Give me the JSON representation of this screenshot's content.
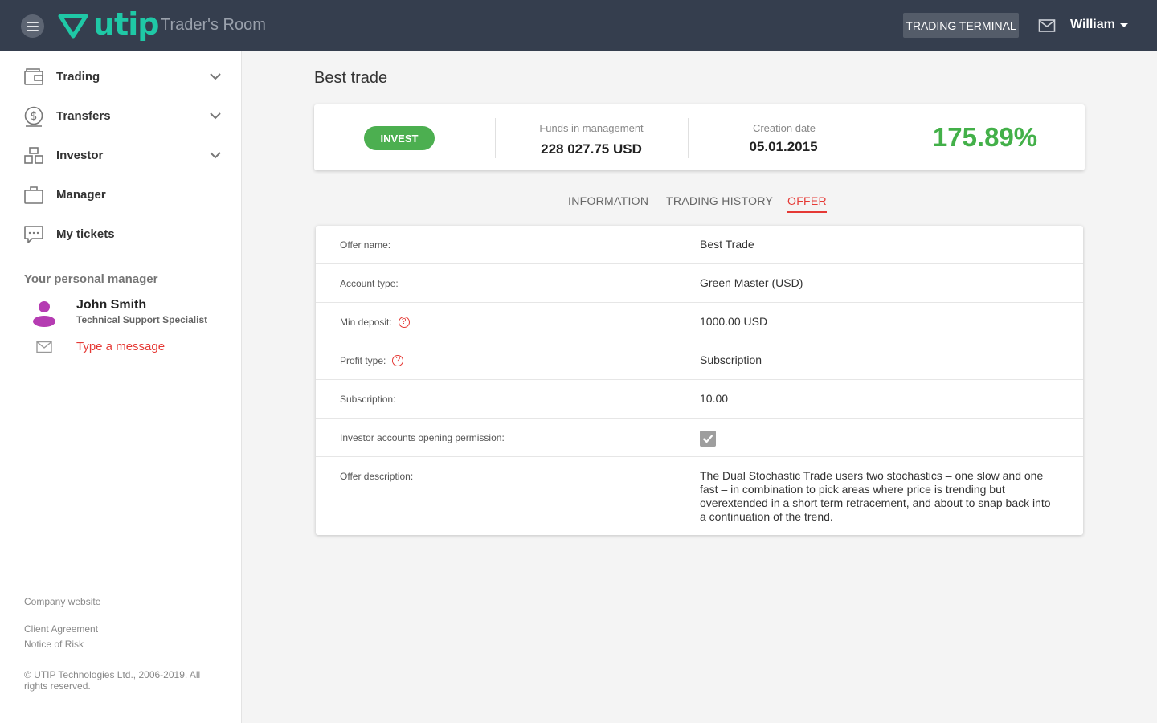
{
  "header": {
    "brand": "utip",
    "app_title": "Trader's Room",
    "terminal_label": "TRADING TERMINAL",
    "user_name": "William",
    "brand_color": "#1fc8a6"
  },
  "sidebar": {
    "items": [
      {
        "label": "Trading",
        "icon": "wallet-icon",
        "expandable": true
      },
      {
        "label": "Transfers",
        "icon": "dollar-circle-icon",
        "expandable": true
      },
      {
        "label": "Investor",
        "icon": "boxes-icon",
        "expandable": true
      },
      {
        "label": "Manager",
        "icon": "briefcase-icon",
        "expandable": false
      },
      {
        "label": "My tickets",
        "icon": "chat-icon",
        "expandable": false
      }
    ],
    "personal_manager": {
      "heading": "Your personal manager",
      "name": "John Smith",
      "role": "Technical Support Specialist",
      "message_link": "Type a message"
    },
    "footer": {
      "company_website": "Company website",
      "client_agreement": "Client Agreement",
      "notice_of_risk": "Notice of Risk",
      "copyright": "© UTIP Technologies Ltd., 2006-2019. All rights reserved."
    }
  },
  "main": {
    "title": "Best trade",
    "stats": {
      "invest_label": "INVEST",
      "funds_label": "Funds in management",
      "funds_value": "228 027.75 USD",
      "creation_label": "Creation date",
      "creation_value": "05.01.2015",
      "profit_pct": "175.89%"
    },
    "tabs": [
      {
        "label": "INFORMATION",
        "active": false
      },
      {
        "label": "TRADING HISTORY",
        "active": false
      },
      {
        "label": "OFFER",
        "active": true
      }
    ],
    "offer": {
      "rows": [
        {
          "label": "Offer name:",
          "value": "Best Trade"
        },
        {
          "label": "Account type:",
          "value": "Green Master (USD)"
        },
        {
          "label": "Min deposit:",
          "value": "1000.00 USD",
          "help": true
        },
        {
          "label": "Profit type:",
          "value": "Subscription",
          "help": true
        },
        {
          "label": "Subscription:",
          "value": "10.00"
        },
        {
          "label": "Investor accounts opening permission:",
          "checked": true
        },
        {
          "label": "Offer description:",
          "value": "The Dual Stochastic Trade users two stochastics – one slow and one fast – in combination to pick areas where price is trending but overextended in a short term retracement, and about to snap back into a continuation of the trend."
        }
      ]
    }
  }
}
